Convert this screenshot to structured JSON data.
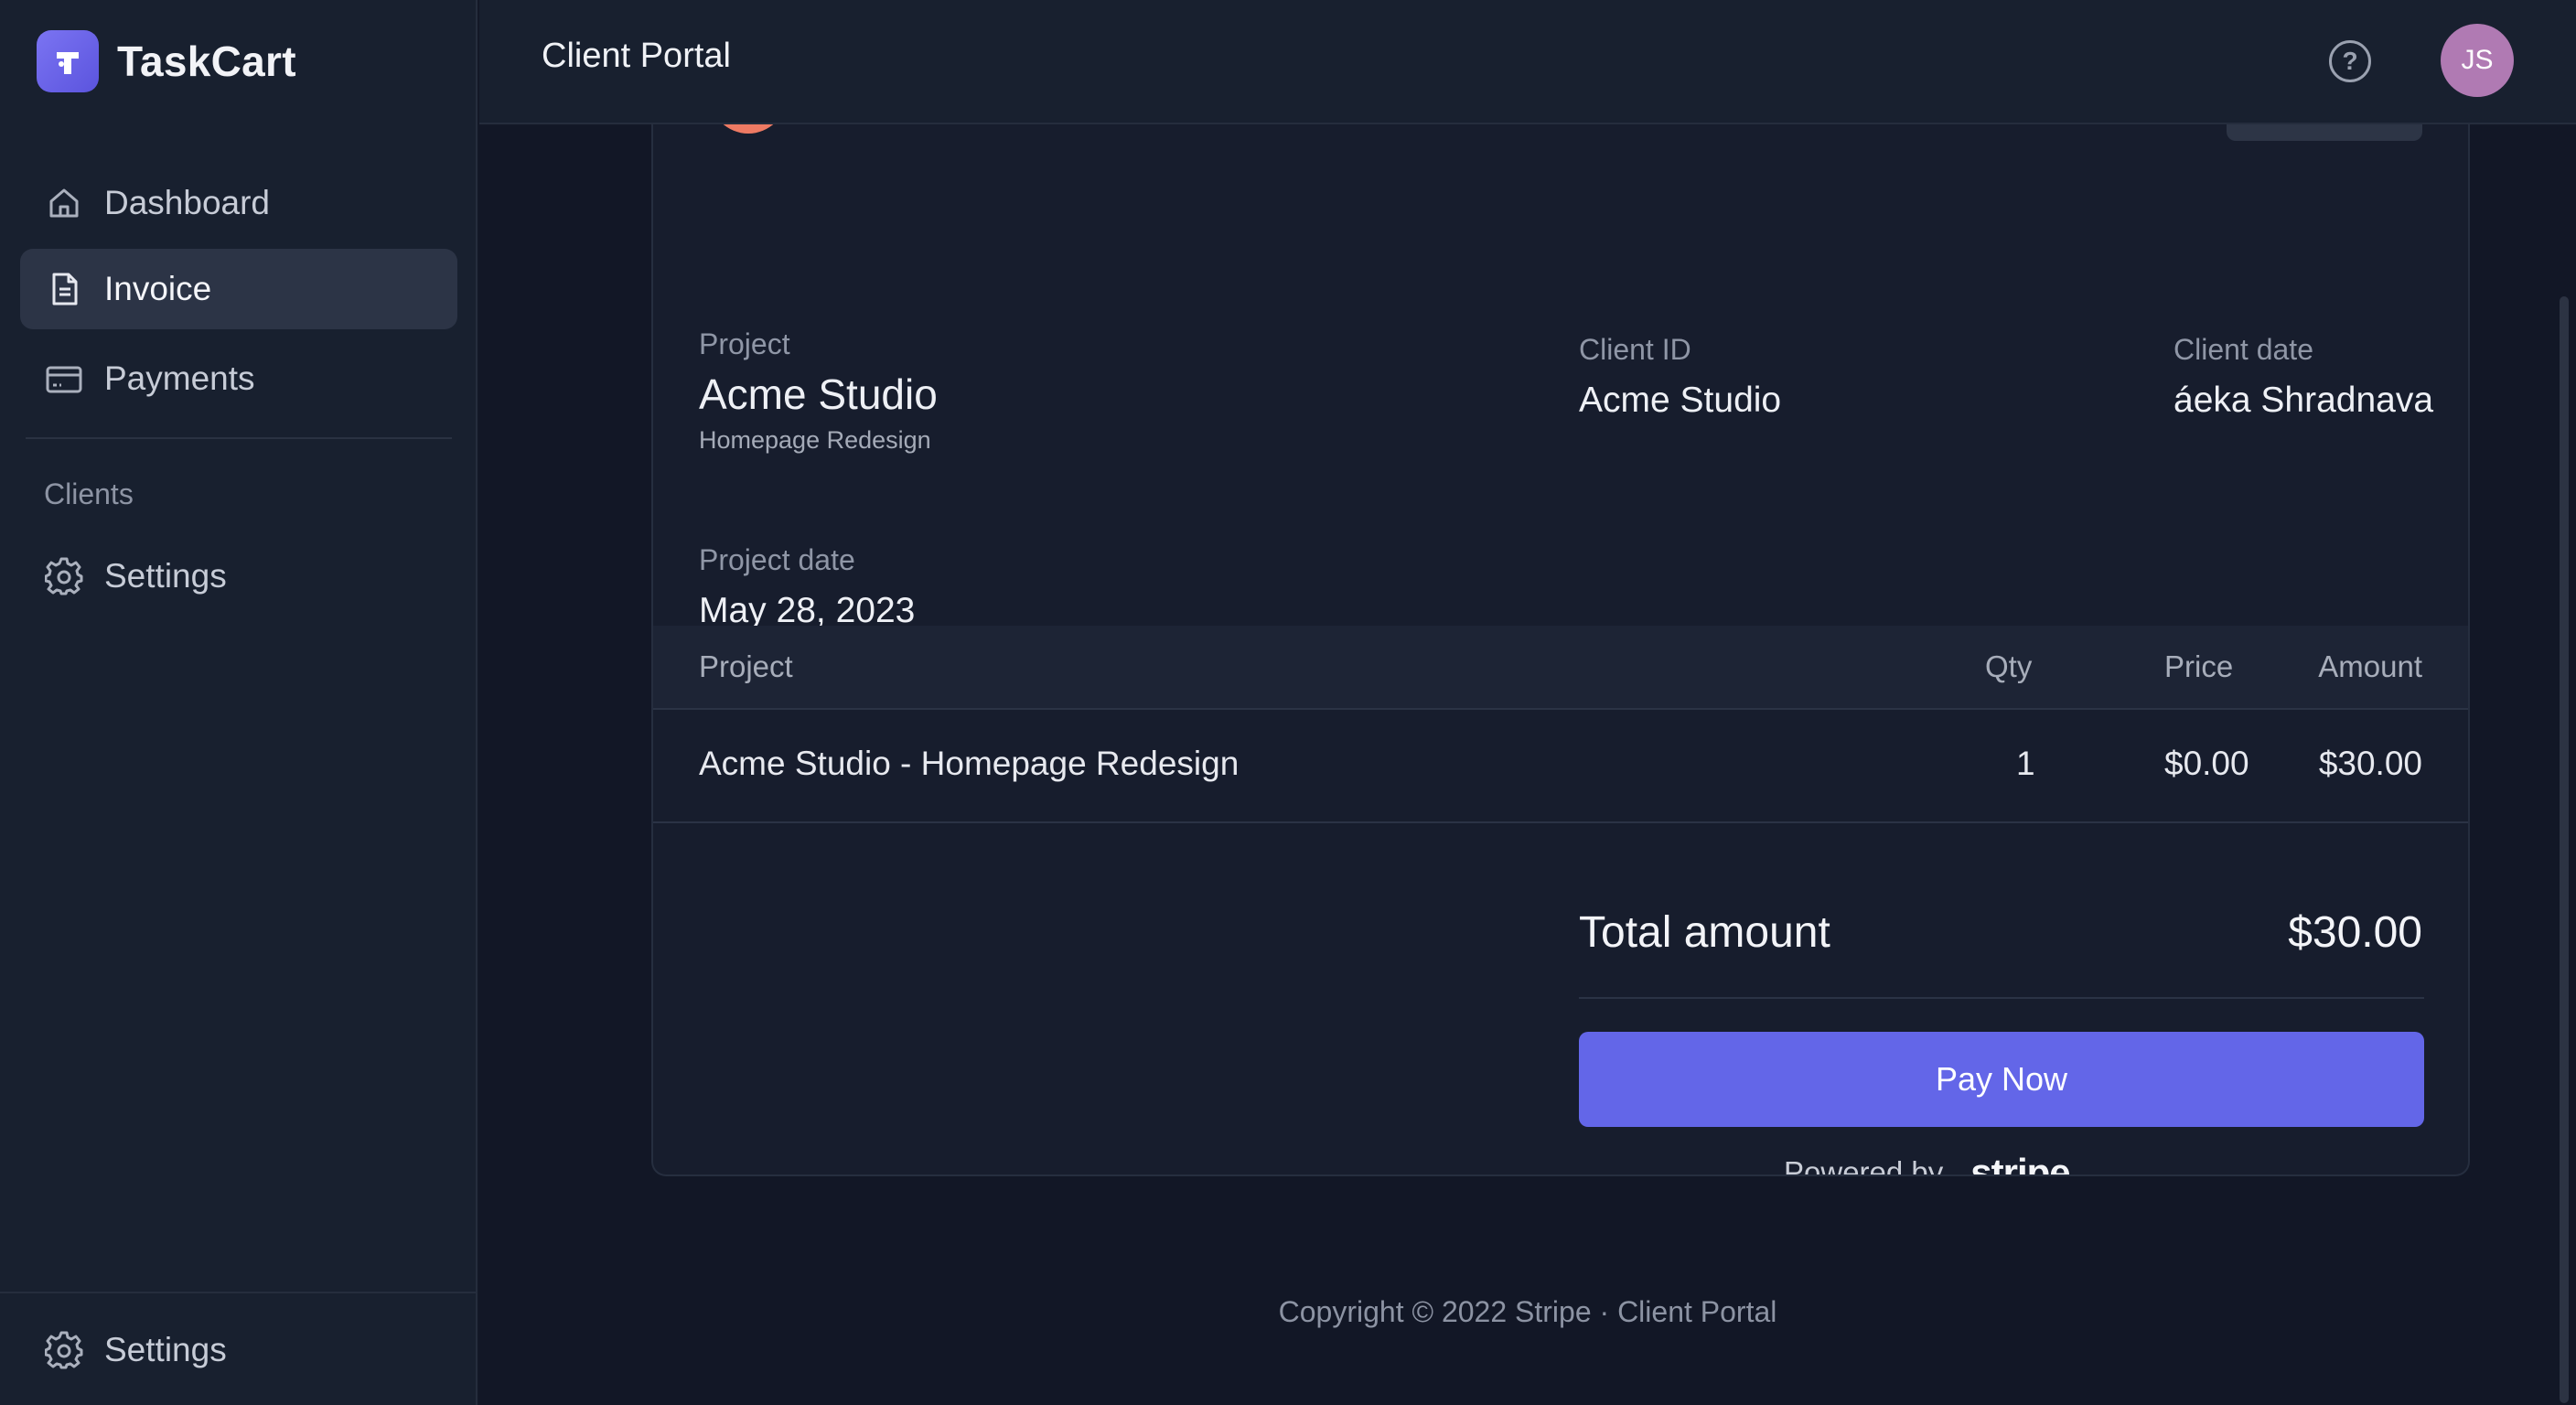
{
  "brand": {
    "name": "TaskCart",
    "logo_letter": "T"
  },
  "sidebar": {
    "items": [
      {
        "label": "Dashboard",
        "icon": "home-icon"
      },
      {
        "label": "Invoice",
        "icon": "document-icon",
        "active": true
      },
      {
        "label": "Payments",
        "icon": "credit-card-icon"
      }
    ],
    "section_label": "Clients",
    "section_items": [
      {
        "label": "Settings",
        "icon": "gear-icon"
      }
    ],
    "bottom_item": {
      "label": "Settings",
      "icon": "gear-icon"
    }
  },
  "header": {
    "title": "Client Portal",
    "help_glyph": "?",
    "avatar_initials": "JS"
  },
  "invoice": {
    "project": {
      "label": "Project",
      "value": "Acme Studio",
      "sub": "Homepage Redesign"
    },
    "client_id": {
      "label": "Client ID",
      "value": "Acme Studio"
    },
    "client_date": {
      "label": "Client date",
      "value": "áeka Shradnava"
    },
    "project_date": {
      "label": "Project date",
      "value": "May 28, 2023"
    },
    "table": {
      "headers": [
        "Project",
        "Qty",
        "Price",
        "Amount"
      ],
      "rows": [
        {
          "project": "Acme Studio - Homepage Redesign",
          "qty": "1",
          "price": "$0.00",
          "amount": "$30.00"
        }
      ]
    },
    "total": {
      "label": "Total amount",
      "value": "$30.00"
    },
    "pay_button": "Pay Now",
    "powered_by": "Powered by",
    "stripe": "stripe"
  },
  "footer": {
    "text": "Copyright © 2022 Stripe · Client Portal"
  },
  "colors": {
    "accent": "#6366e8",
    "logo_orange": "#ee7a63",
    "avatar": "#b07ab3",
    "background": "#121726",
    "sidebar": "#18202f"
  }
}
